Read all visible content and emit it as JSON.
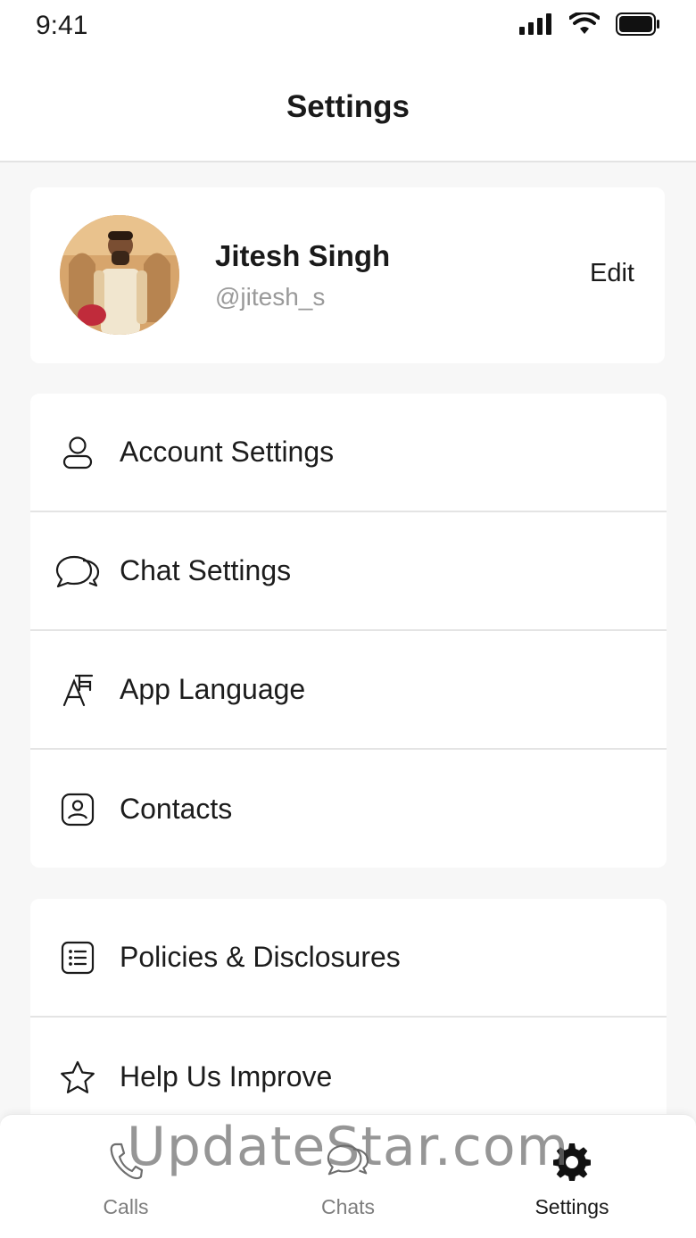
{
  "status_bar": {
    "time": "9:41"
  },
  "header": {
    "title": "Settings"
  },
  "profile": {
    "name": "Jitesh Singh",
    "handle": "@jitesh_s",
    "edit_label": "Edit"
  },
  "settings_group_1": [
    {
      "label": "Account Settings",
      "icon": "user-icon"
    },
    {
      "label": "Chat Settings",
      "icon": "chat-bubbles-icon"
    },
    {
      "label": "App Language",
      "icon": "language-icon"
    },
    {
      "label": "Contacts",
      "icon": "contact-card-icon"
    }
  ],
  "settings_group_2": [
    {
      "label": "Policies & Disclosures",
      "icon": "list-icon"
    },
    {
      "label": "Help Us Improve",
      "icon": "star-icon"
    }
  ],
  "tab_bar": {
    "tabs": [
      {
        "label": "Calls",
        "icon": "phone-icon",
        "active": false
      },
      {
        "label": "Chats",
        "icon": "chat-bubbles-icon",
        "active": false
      },
      {
        "label": "Settings",
        "icon": "gear-icon",
        "active": true
      }
    ]
  },
  "watermark": "UpdateStar.com"
}
